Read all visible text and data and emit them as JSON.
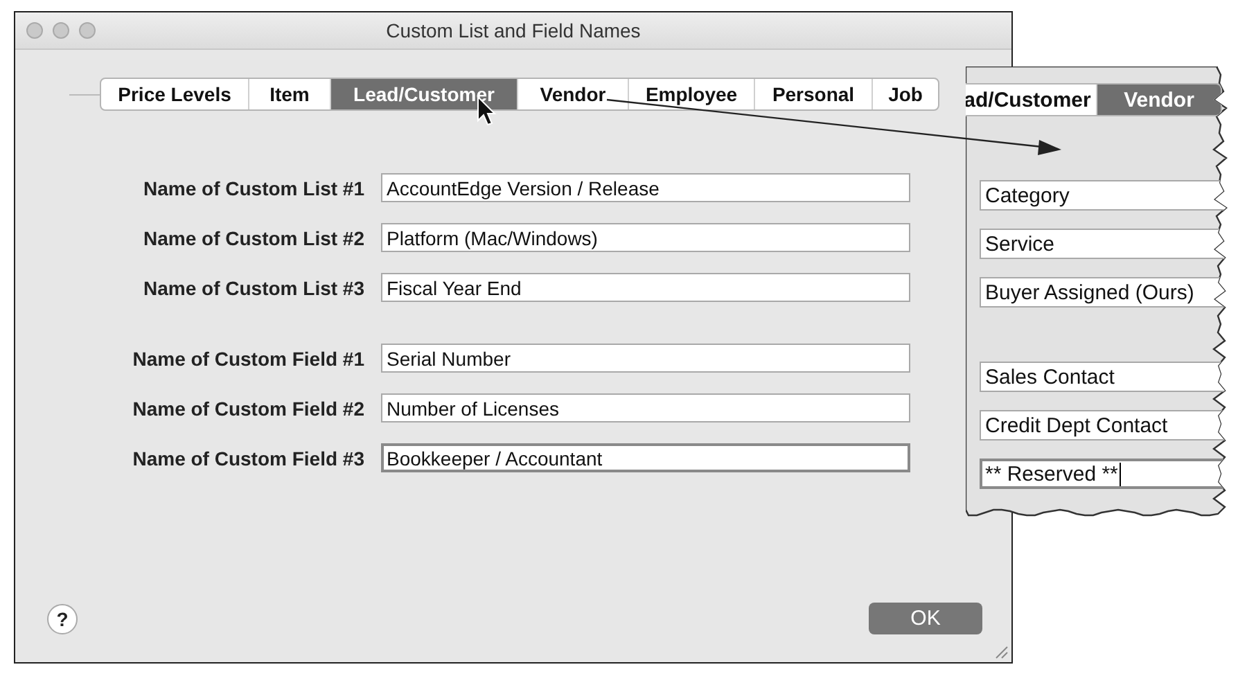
{
  "window": {
    "title": "Custom List and Field Names"
  },
  "tabs": [
    {
      "label": "Price Levels",
      "selected": false
    },
    {
      "label": "Item",
      "selected": false
    },
    {
      "label": "Lead/Customer",
      "selected": true
    },
    {
      "label": "Vendor",
      "selected": false
    },
    {
      "label": "Employee",
      "selected": false
    },
    {
      "label": "Personal",
      "selected": false
    },
    {
      "label": "Job",
      "selected": false
    }
  ],
  "custom_lists": [
    {
      "label": "Name of Custom List #1",
      "value": "AccountEdge Version / Release",
      "focused": false
    },
    {
      "label": "Name of Custom List #2",
      "value": "Platform (Mac/Windows)",
      "focused": false
    },
    {
      "label": "Name of Custom List #3",
      "value": "Fiscal Year End",
      "focused": false
    }
  ],
  "custom_fields": [
    {
      "label": "Name of Custom Field #1",
      "value": "Serial Number",
      "focused": false
    },
    {
      "label": "Name of Custom Field #2",
      "value": "Number of Licenses",
      "focused": false
    },
    {
      "label": "Name of Custom Field #3",
      "value": "Bookkeeper / Accountant",
      "focused": true
    }
  ],
  "help_button": "?",
  "ok_button": "OK",
  "inset": {
    "tabs": [
      {
        "label": "ad/Customer",
        "selected": false
      },
      {
        "label": "Vendor",
        "selected": true
      }
    ],
    "custom_lists": [
      {
        "value": "Category",
        "focused": false
      },
      {
        "value": "Service",
        "focused": false
      },
      {
        "value": "Buyer Assigned (Ours)",
        "focused": false
      }
    ],
    "custom_fields": [
      {
        "value": "Sales Contact",
        "focused": false
      },
      {
        "value": "Credit Dept Contact",
        "focused": false
      },
      {
        "value": "** Reserved **",
        "focused": true
      }
    ]
  }
}
